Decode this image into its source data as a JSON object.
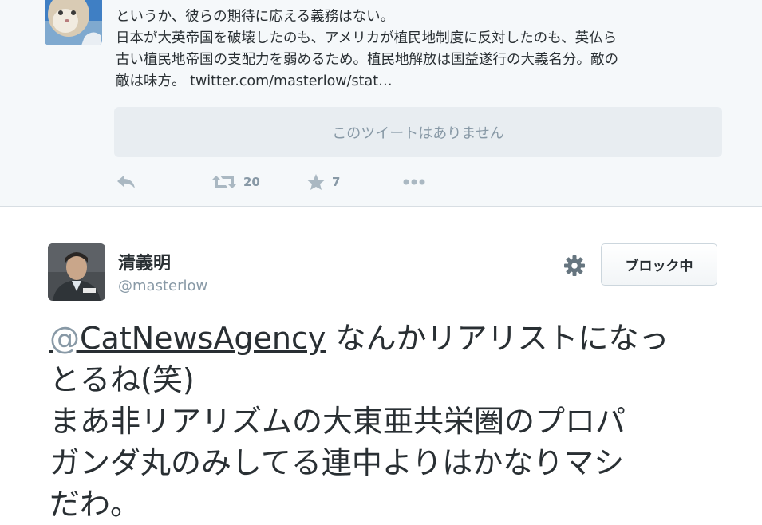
{
  "parent_tweet": {
    "lines": [
      "というか、彼らの期待に応える義務はない。",
      "日本が大英帝国を破壊したのも、アメリカが植民地制度に反対したのも、英仏ら",
      "古い植民地帝国の支配力を弱めるため。植民地解放は国益遂行の大義名分。敵の",
      "敵は味方。"
    ],
    "link_text": "twitter.com/masterlow/stat…",
    "quoted_unavailable": "このツイートはありません",
    "actions": {
      "reply_icon": "reply-icon",
      "retweet_icon": "retweet-icon",
      "retweet_count": "20",
      "favorite_icon": "star-icon",
      "favorite_count": "7",
      "more_icon": "more-dots-icon"
    }
  },
  "tweet": {
    "user": {
      "display_name": "清義明",
      "screen_name": "@masterlow"
    },
    "block_button_label": "ブロック中",
    "settings_icon": "gear-icon",
    "mention_at": "@",
    "mention_name": "CatNewsAgency",
    "body_line1_rest": " なんかリアリストになっ",
    "body_lines": [
      "とるね(笑)",
      "まあ非リアリズムの大東亜共栄圏のプロパ",
      "ガンダ丸のみしてる連中よりはかなりマシ",
      "だわ。"
    ]
  },
  "colors": {
    "text": "#292f33",
    "muted": "#8899a6",
    "icon": "#aab8c2",
    "top_background": "#f5f8fa",
    "quote_background": "#e8edf1"
  }
}
